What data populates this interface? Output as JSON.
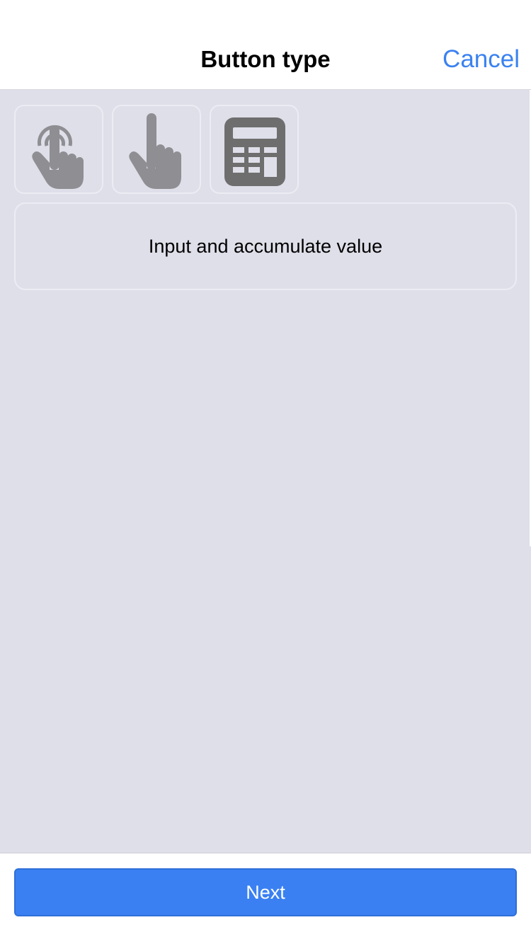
{
  "nav": {
    "title": "Button type",
    "cancel_label": "Cancel"
  },
  "button_types": [
    {
      "icon": "hand-tap-ripple-icon",
      "selected": false
    },
    {
      "icon": "hand-pointer-icon",
      "selected": false
    },
    {
      "icon": "calculator-icon",
      "selected": true
    }
  ],
  "description": "Input and accumulate value",
  "footer": {
    "next_label": "Next"
  },
  "colors": {
    "accent": "#3a80f2",
    "background": "#dfdfea",
    "icon_inactive": "#8e8e93",
    "icon_active": "#6e6e6e"
  }
}
